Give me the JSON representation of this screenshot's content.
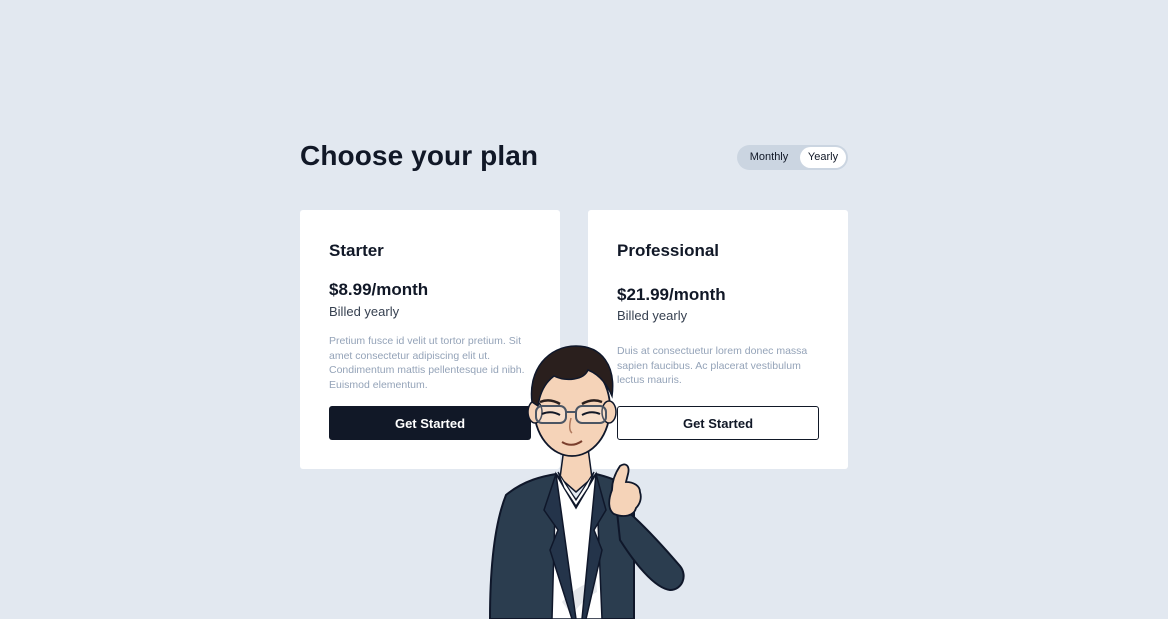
{
  "header": {
    "title": "Choose your plan"
  },
  "billing_toggle": {
    "monthly_label": "Monthly",
    "yearly_label": "Yearly",
    "selected": "Yearly"
  },
  "plans": [
    {
      "name": "Starter",
      "price": "$8.99/month",
      "billing_note": "Billed yearly",
      "description": "Pretium fusce id velit ut tortor pretium. Sit amet consectetur adipiscing elit ut. Condimentum mattis pellentesque id nibh. Euismod elementum.",
      "button_label": "Get Started"
    },
    {
      "name": "Professional",
      "price": "$21.99/month",
      "billing_note": "Billed yearly",
      "description": "Duis at consectuetur lorem donec massa sapien faucibus. Ac placerat vestibulum lectus mauris.",
      "button_label": "Get Started"
    }
  ],
  "colors": {
    "background": "#e2e8f0",
    "card": "#ffffff",
    "primary": "#111827",
    "muted_text": "#94a3b8",
    "suit": "#2b3d4f"
  },
  "icons": {
    "mascot": "thumbs-up-man-illustration"
  }
}
